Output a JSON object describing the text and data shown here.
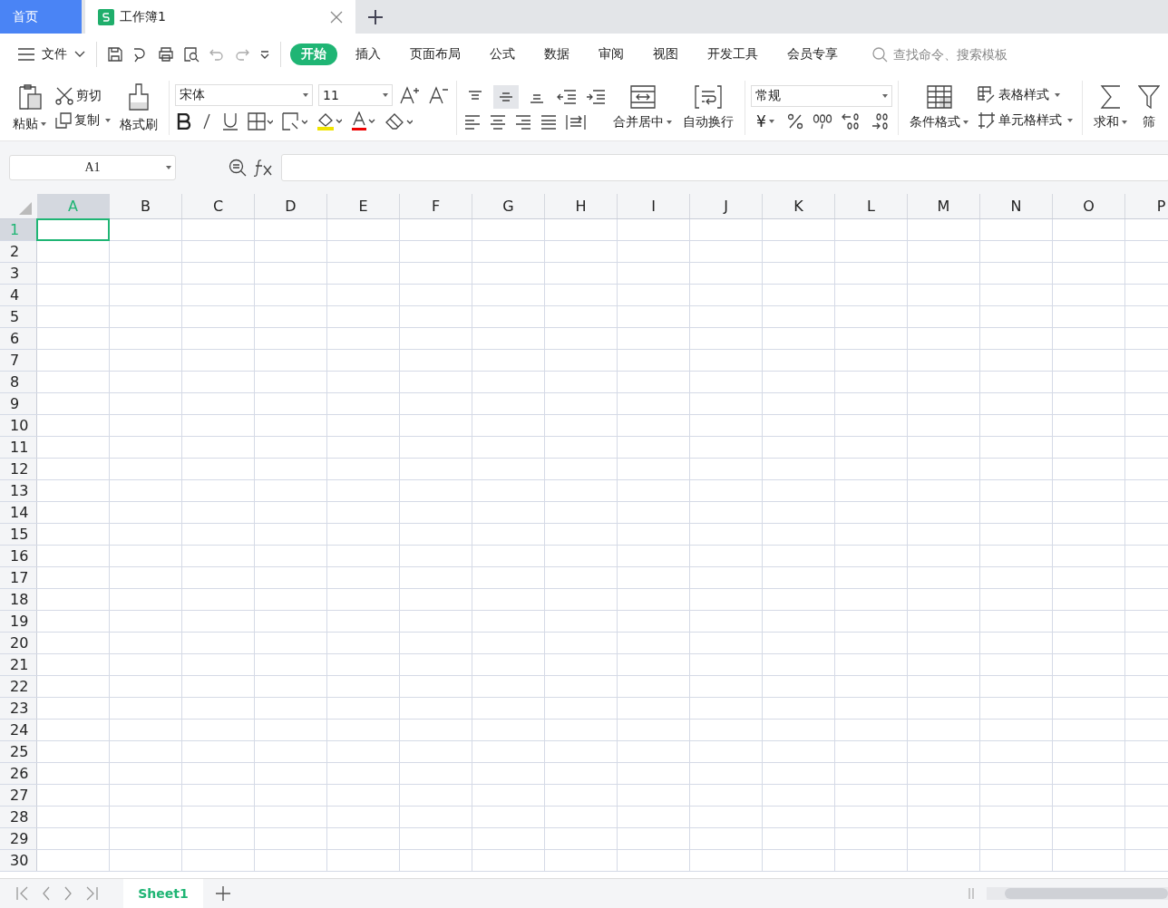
{
  "tabs": [
    {
      "label": "首页",
      "kind": "home",
      "selected": false
    },
    {
      "label": "工作簿1",
      "kind": "doc",
      "selected": true
    }
  ],
  "menu": {
    "file": "文件",
    "ribbon_tabs": [
      {
        "label": "开始",
        "selected": true
      },
      {
        "label": "插入",
        "selected": false
      },
      {
        "label": "页面布局",
        "selected": false
      },
      {
        "label": "公式",
        "selected": false
      },
      {
        "label": "数据",
        "selected": false
      },
      {
        "label": "审阅",
        "selected": false
      },
      {
        "label": "视图",
        "selected": false
      },
      {
        "label": "开发工具",
        "selected": false
      },
      {
        "label": "会员专享",
        "selected": false
      }
    ],
    "search": {
      "placeholder": "查找命令、搜索模板"
    }
  },
  "ribbon": {
    "paste": "粘贴",
    "cut": "剪切",
    "copy": "复制",
    "format_painter": "格式刷",
    "font_name": "宋体",
    "font_size": "11",
    "vertical_align": [
      {
        "kind": "top",
        "on": false
      },
      {
        "kind": "middle",
        "on": true
      },
      {
        "kind": "bottom",
        "on": false
      }
    ],
    "merge": "合并居中",
    "wrap": "自动换行",
    "number_format": "常规",
    "currency": "¥",
    "conditional_format": "条件格式",
    "table_style": "表格样式",
    "cell_style": "单元格样式",
    "sum": "求和",
    "filter": "筛"
  },
  "formula_bar": {
    "name_box": "A1"
  },
  "sheet": {
    "columns": [
      {
        "label": "A",
        "selected": true
      },
      {
        "label": "B",
        "selected": false
      },
      {
        "label": "C",
        "selected": false
      },
      {
        "label": "D",
        "selected": false
      },
      {
        "label": "E",
        "selected": false
      },
      {
        "label": "F",
        "selected": false
      },
      {
        "label": "G",
        "selected": false
      },
      {
        "label": "H",
        "selected": false
      },
      {
        "label": "I",
        "selected": false
      },
      {
        "label": "J",
        "selected": false
      },
      {
        "label": "K",
        "selected": false
      },
      {
        "label": "L",
        "selected": false
      },
      {
        "label": "M",
        "selected": false
      },
      {
        "label": "N",
        "selected": false
      },
      {
        "label": "O",
        "selected": false
      },
      {
        "label": "P",
        "selected": false
      }
    ],
    "rows": [
      {
        "label": "1",
        "selected": true
      },
      {
        "label": "2",
        "selected": false
      },
      {
        "label": "3",
        "selected": false
      },
      {
        "label": "4",
        "selected": false
      },
      {
        "label": "5",
        "selected": false
      },
      {
        "label": "6",
        "selected": false
      },
      {
        "label": "7",
        "selected": false
      },
      {
        "label": "8",
        "selected": false
      },
      {
        "label": "9",
        "selected": false
      },
      {
        "label": "10",
        "selected": false
      },
      {
        "label": "11",
        "selected": false
      },
      {
        "label": "12",
        "selected": false
      },
      {
        "label": "13",
        "selected": false
      },
      {
        "label": "14",
        "selected": false
      },
      {
        "label": "15",
        "selected": false
      },
      {
        "label": "16",
        "selected": false
      },
      {
        "label": "17",
        "selected": false
      },
      {
        "label": "18",
        "selected": false
      },
      {
        "label": "19",
        "selected": false
      },
      {
        "label": "20",
        "selected": false
      },
      {
        "label": "21",
        "selected": false
      },
      {
        "label": "22",
        "selected": false
      },
      {
        "label": "23",
        "selected": false
      },
      {
        "label": "24",
        "selected": false
      },
      {
        "label": "25",
        "selected": false
      },
      {
        "label": "26",
        "selected": false
      },
      {
        "label": "27",
        "selected": false
      },
      {
        "label": "28",
        "selected": false
      },
      {
        "label": "29",
        "selected": false
      },
      {
        "label": "30",
        "selected": false
      }
    ]
  },
  "sheet_tabs": [
    {
      "label": "Sheet1",
      "selected": true
    }
  ]
}
